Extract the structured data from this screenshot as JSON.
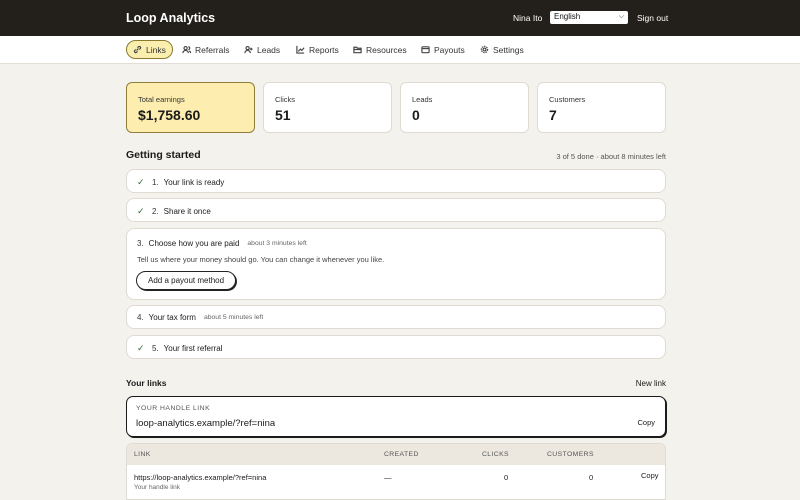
{
  "header": {
    "brand": "Loop Analytics",
    "user_name": "Nina Ito",
    "language": "English",
    "sign_out": "Sign out"
  },
  "nav": {
    "items": [
      {
        "label": "Links",
        "icon": "link-icon",
        "active": true
      },
      {
        "label": "Referrals",
        "icon": "users-icon"
      },
      {
        "label": "Leads",
        "icon": "user-plus-icon"
      },
      {
        "label": "Reports",
        "icon": "chart-icon"
      },
      {
        "label": "Resources",
        "icon": "folder-icon"
      },
      {
        "label": "Payouts",
        "icon": "wallet-icon"
      },
      {
        "label": "Settings",
        "icon": "gear-icon"
      }
    ]
  },
  "stats": [
    {
      "label": "Total earnings",
      "value": "$1,758.60"
    },
    {
      "label": "Clicks",
      "value": "51"
    },
    {
      "label": "Leads",
      "value": "0"
    },
    {
      "label": "Customers",
      "value": "7"
    }
  ],
  "getting_started": {
    "title": "Getting started",
    "progress": "3 of 5 done · about 8 minutes left",
    "steps": [
      {
        "num": "1.",
        "label": "Your link is ready",
        "done": true
      },
      {
        "num": "2.",
        "label": "Share it once",
        "done": true
      },
      {
        "num": "3.",
        "label": "Choose how you are paid",
        "time": "about 3 minutes left",
        "desc": "Tell us where your money should go. You can change it whenever you like.",
        "button": "Add a payout method",
        "done": false
      },
      {
        "num": "4.",
        "label": "Your tax form",
        "time": "about 5 minutes left",
        "done": false
      },
      {
        "num": "5.",
        "label": "Your first referral",
        "done": true
      }
    ]
  },
  "links": {
    "title": "Your links",
    "new_link": "New link",
    "handle_label": "YOUR HANDLE LINK",
    "handle_url": "loop-analytics.example/?ref=nina",
    "copy": "Copy",
    "columns": [
      "LINK",
      "CREATED",
      "CLICKS",
      "CUSTOMERS"
    ],
    "rows": [
      {
        "url": "https://loop-analytics.example/?ref=nina",
        "note": "Your handle link",
        "created": "—",
        "clicks": "0",
        "customers": "0",
        "copy": "Copy"
      }
    ]
  },
  "colors": {
    "topbar": "#231f1b",
    "accent": "#fdeeb0",
    "check": "#2d6a3c"
  }
}
